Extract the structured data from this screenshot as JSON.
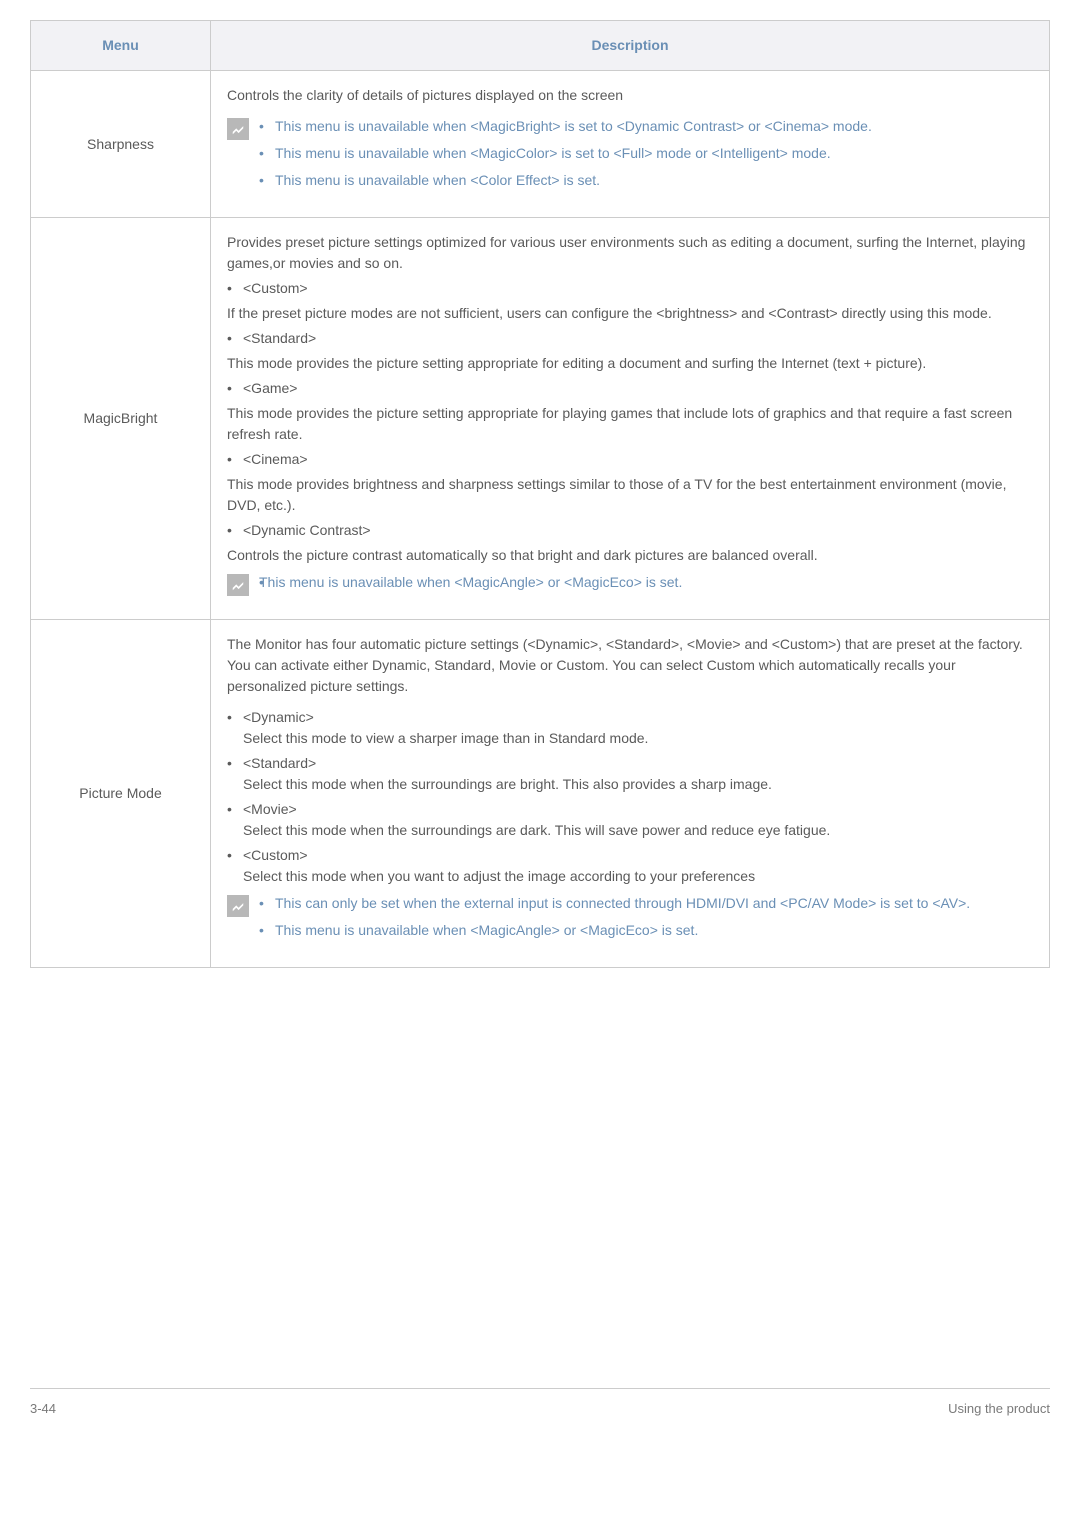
{
  "table": {
    "headers": {
      "menu": "Menu",
      "description": "Description"
    }
  },
  "rows": {
    "sharpness": {
      "menu": "Sharpness",
      "intro": "Controls the clarity of details of pictures displayed on the screen",
      "notes": [
        "This menu is unavailable when <MagicBright> is set to <Dynamic Contrast> or <Cinema> mode.",
        "This menu is unavailable when <MagicColor> is set to <Full> mode or <Intelligent> mode.",
        "This menu is unavailable when <Color Effect> is set."
      ]
    },
    "magicbright": {
      "menu": "MagicBright",
      "intro": "Provides preset picture settings optimized for various user environments such as editing a document, surfing the Internet, playing games,or movies and so on.",
      "opt_custom": "<Custom>",
      "opt_custom_desc": "If the preset picture modes are not sufficient, users can configure the <brightness> and <Contrast> directly using this mode.",
      "opt_standard": "<Standard>",
      "opt_standard_desc": " This mode provides the picture setting appropriate for editing a document and surfing the Internet (text + picture).",
      "opt_game": "<Game>",
      "opt_game_desc": "This mode provides the picture setting appropriate for playing games that include lots of graphics and that require a fast screen refresh rate.",
      "opt_cinema": "<Cinema>",
      "opt_cinema_desc": "This mode provides brightness and sharpness settings similar to those of a TV for the best entertainment environment (movie, DVD, etc.).",
      "opt_dc": "<Dynamic Contrast>",
      "opt_dc_desc": "Controls the picture contrast automatically so that bright and dark pictures are balanced overall.",
      "note": "This menu is unavailable when <MagicAngle> or <MagicEco> is set."
    },
    "picturemode": {
      "menu": "Picture Mode",
      "intro": "The Monitor has four automatic picture settings (<Dynamic>, <Standard>, <Movie> and <Custom>) that are preset at the factory. You can activate either Dynamic, Standard, Movie or Custom. You can select Custom which automatically recalls your personalized picture settings.",
      "opt_dynamic": "<Dynamic>",
      "opt_dynamic_desc": "Select this mode to view a sharper image than in Standard mode.",
      "opt_standard": "<Standard>",
      "opt_standard_desc": "Select this mode when the surroundings are bright. This also provides a sharp image.",
      "opt_movie": "<Movie>",
      "opt_movie_desc": "Select this mode when the surroundings are dark. This will save power and reduce eye fatigue.",
      "opt_custom": "<Custom>",
      "opt_custom_desc": "Select this mode when you want to adjust the image according to your preferences",
      "notes": [
        "This can only be set when the external input is connected through HDMI/DVI and <PC/AV Mode> is set to <AV>.",
        "This menu is unavailable when <MagicAngle> or <MagicEco> is set."
      ]
    }
  },
  "footer": {
    "left": "3-44",
    "right": "Using the product"
  }
}
